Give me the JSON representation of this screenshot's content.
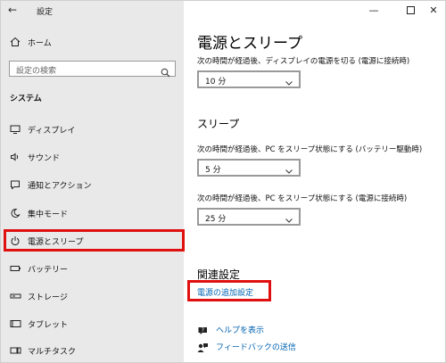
{
  "window": {
    "title": "設定"
  },
  "sidebar": {
    "home_label": "ホーム",
    "search_placeholder": "設定の検索",
    "section_title": "システム",
    "items": [
      {
        "label": "ディスプレイ",
        "icon": "monitor-icon"
      },
      {
        "label": "サウンド",
        "icon": "speaker-icon"
      },
      {
        "label": "通知とアクション",
        "icon": "notification-icon"
      },
      {
        "label": "集中モード",
        "icon": "moon-icon"
      },
      {
        "label": "電源とスリープ",
        "icon": "power-icon",
        "selected": true
      },
      {
        "label": "バッテリー",
        "icon": "battery-icon"
      },
      {
        "label": "ストレージ",
        "icon": "storage-icon"
      },
      {
        "label": "タブレット",
        "icon": "tablet-icon"
      },
      {
        "label": "マルチタスク",
        "icon": "multitask-icon"
      }
    ]
  },
  "main": {
    "title": "電源とスリープ",
    "screen_label": "次の時間が経過後、ディスプレイの電源を切る (電源に接続時)",
    "screen_value": "10 分",
    "sleep_title": "スリープ",
    "sleep_battery_label": "次の時間が経過後、PC をスリープ状態にする (バッテリー駆動時)",
    "sleep_battery_value": "5 分",
    "sleep_plugged_label": "次の時間が経過後、PC をスリープ状態にする (電源に接続時)",
    "sleep_plugged_value": "25 分",
    "related_title": "関連設定",
    "related_link": "電源の追加設定",
    "help_link": "ヘルプを表示",
    "feedback_link": "フィードバックの送信"
  },
  "colors": {
    "accent": "#0063b1",
    "highlight": "#e01010",
    "sidebar_bg": "#e9e9e9"
  }
}
